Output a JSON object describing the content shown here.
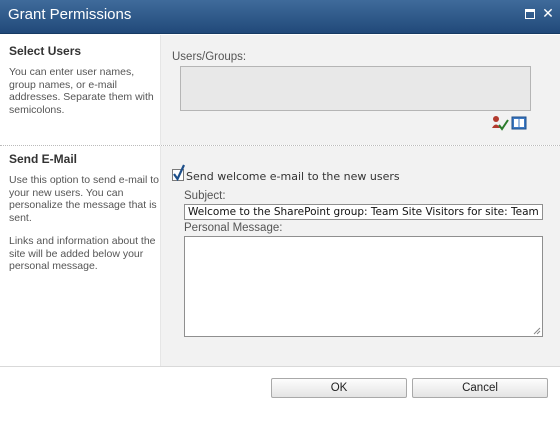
{
  "window": {
    "title": "Grant Permissions",
    "maximize_icon": "maximize-icon",
    "close_icon": "close-icon",
    "close_glyph": "✕"
  },
  "select_users": {
    "heading": "Select Users",
    "description": "You can enter user names, group names, or e-mail addresses. Separate them with semicolons.",
    "field_label": "Users/Groups:",
    "field_value": "",
    "check_names_icon": "check-names-icon",
    "browse_icon": "address-book-icon"
  },
  "send_email": {
    "heading": "Send E-Mail",
    "description_1": "Use this option to send e-mail to your new users. You can personalize the message that is sent.",
    "description_2": "Links and information about the site will be added below your personal message.",
    "checkbox_label": "Send welcome e-mail to the new users",
    "checkbox_checked": true,
    "subject_label": "Subject:",
    "subject_value": "Welcome to the SharePoint group: Team Site Visitors for site: Team Site",
    "message_label": "Personal Message:",
    "message_value": ""
  },
  "footer": {
    "ok_label": "OK",
    "cancel_label": "Cancel"
  },
  "colors": {
    "titlebar": "#2b5687",
    "panel": "#f2f2f2",
    "checkmark": "#1d4f8a"
  }
}
